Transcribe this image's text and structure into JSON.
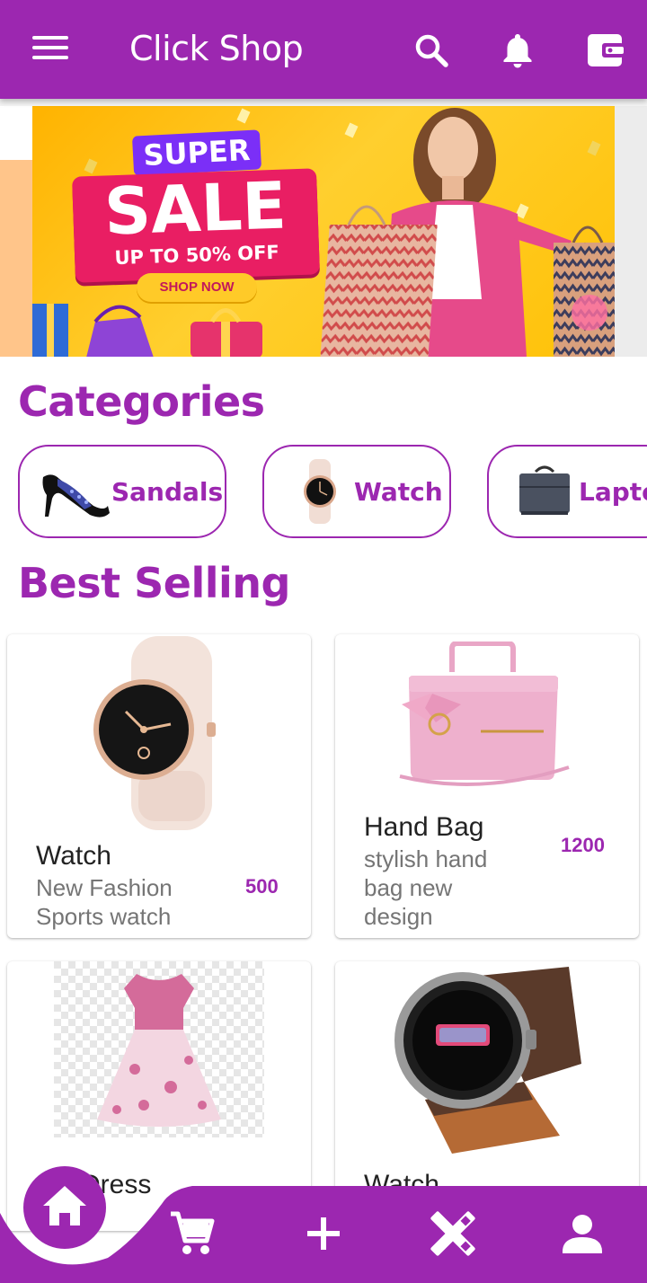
{
  "app_bar": {
    "title": "Click Shop",
    "icons": [
      "menu-icon",
      "search-icon",
      "bell-icon",
      "wallet-icon"
    ]
  },
  "banner": {
    "super": "SUPER",
    "sale": "SALE",
    "offer": "UP TO 50% OFF",
    "cta": "SHOP NOW"
  },
  "categories": {
    "title": "Categories",
    "items": [
      {
        "label": "Sandals",
        "icon": "sandal-image"
      },
      {
        "label": "Watch",
        "icon": "watch-image"
      },
      {
        "label": "Lapto",
        "icon": "laptop-bag-image"
      }
    ]
  },
  "best_selling": {
    "title": "Best Selling",
    "products": [
      {
        "name": "Watch",
        "desc_line1": "New Fashion",
        "desc_line2": "Sports watch",
        "desc_line3": "",
        "price": "500"
      },
      {
        "name": "Hand Bag",
        "desc_line1": "stylish hand",
        "desc_line2": "bag new",
        "desc_line3": "design",
        "price": "1200"
      },
      {
        "name": "Dress",
        "desc_line1": "",
        "desc_line2": "",
        "desc_line3": "",
        "price": ""
      },
      {
        "name": "Watch",
        "desc_line1": "",
        "desc_line2": "",
        "desc_line3": "",
        "price": ""
      }
    ]
  },
  "bottom_nav": {
    "items": [
      "home-icon",
      "cart-icon",
      "add-icon",
      "tools-icon",
      "profile-icon"
    ]
  },
  "colors": {
    "primary": "#9c27b0",
    "banner_yellow": "#ffc107",
    "sale_pink": "#e91e63",
    "text_gray": "#757575"
  }
}
